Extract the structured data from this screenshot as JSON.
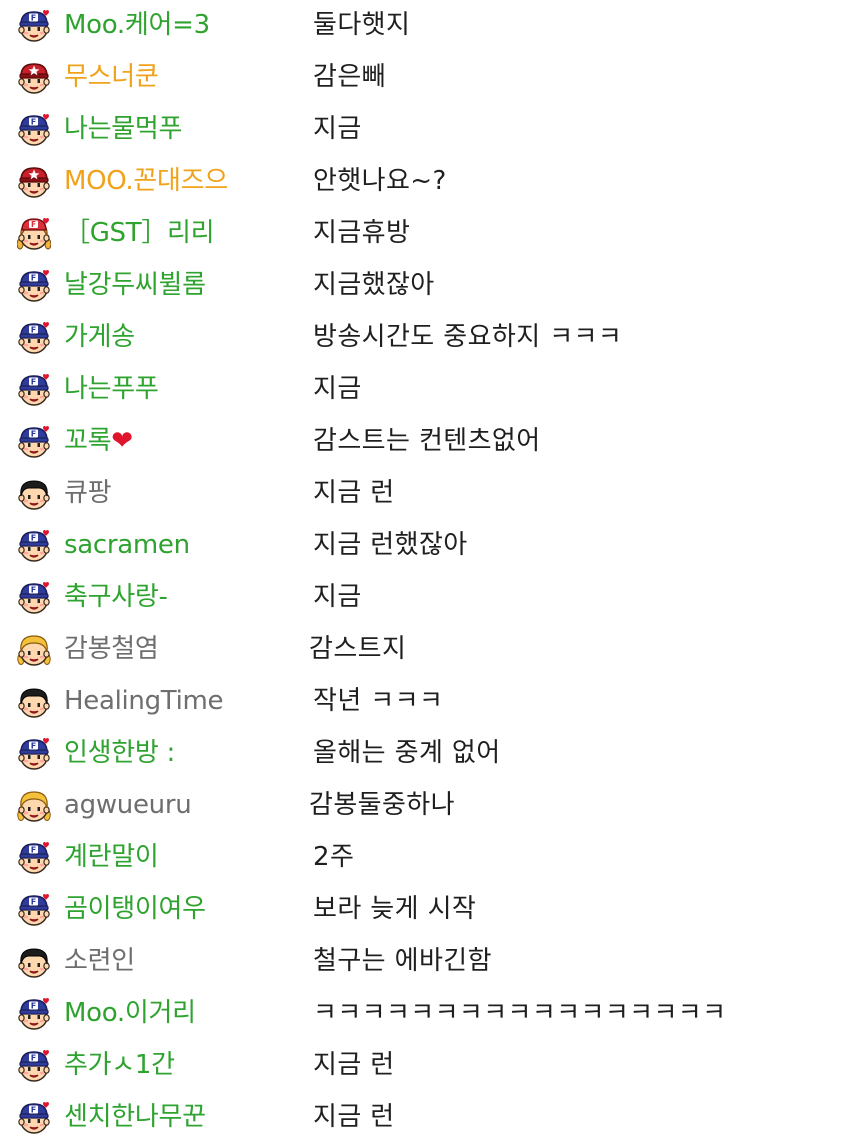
{
  "colors": {
    "fan_nick": "#2fa32f",
    "manager_nick": "#f0a21a",
    "normal_nick": "#6e6e6e",
    "message": "#1f1f1f",
    "heart": "#e0142c"
  },
  "chat": {
    "messages": [
      {
        "nickname": "Moo.케어=3",
        "text": "둘다햇지",
        "badge": "fan-badge-icon",
        "nick_color": "green"
      },
      {
        "nickname": "무스너쿤",
        "text": "감은빼",
        "badge": "manager-badge-icon",
        "nick_color": "orange"
      },
      {
        "nickname": "나는물먹푸",
        "text": "지금",
        "badge": "fan-badge-icon",
        "nick_color": "green"
      },
      {
        "nickname": "MOO.꼰대즈으",
        "text": "안햇나요~?",
        "badge": "manager-badge-icon",
        "nick_color": "orange"
      },
      {
        "nickname": "［GST］리리",
        "text": "지금휴방",
        "badge": "girl-fan-badge-icon",
        "nick_color": "green"
      },
      {
        "nickname": "날강두씨뷜롬",
        "text": "지금했잖아",
        "badge": "fan-badge-icon",
        "nick_color": "green"
      },
      {
        "nickname": "가게송",
        "text": "방송시간도 중요하지 ㅋㅋㅋ",
        "badge": "fan-badge-icon",
        "nick_color": "green"
      },
      {
        "nickname": "나는푸푸",
        "text": "지금",
        "badge": "fan-badge-icon",
        "nick_color": "green"
      },
      {
        "nickname": "꼬록",
        "nick_suffix": "❤",
        "text": "감스트는 컨텐츠없어",
        "badge": "fan-badge-icon",
        "nick_color": "green"
      },
      {
        "nickname": "큐팡",
        "text": "지금 런",
        "badge": "boy-user-icon",
        "nick_color": "gray"
      },
      {
        "nickname": "sacramen",
        "text": "지금 런했잖아",
        "badge": "fan-badge-icon",
        "nick_color": "green"
      },
      {
        "nickname": "축구사랑-",
        "text": "지금",
        "badge": "fan-badge-icon",
        "nick_color": "green"
      },
      {
        "nickname": "감봉철염",
        "text": "감스트지",
        "badge": "girl-user-icon",
        "nick_color": "gray"
      },
      {
        "nickname": "HealingTime",
        "text": "작년 ㅋㅋㅋ",
        "badge": "boy-user-icon",
        "nick_color": "gray"
      },
      {
        "nickname": "인생한방 :",
        "text": "올해는 중계 없어",
        "badge": "fan-badge-icon",
        "nick_color": "green"
      },
      {
        "nickname": "agwueuru",
        "text": "감봉둘중하나",
        "badge": "girl-user-icon",
        "nick_color": "gray"
      },
      {
        "nickname": "계란말이",
        "text": "2주",
        "badge": "fan-badge-icon",
        "nick_color": "green"
      },
      {
        "nickname": "곰이탱이여우",
        "text": "보라 늦게 시작",
        "badge": "fan-badge-icon",
        "nick_color": "green"
      },
      {
        "nickname": "소련인",
        "text": "철구는 에바긴함",
        "badge": "boy-user-icon",
        "nick_color": "gray"
      },
      {
        "nickname": "Moo.이거리",
        "text": "ㅋㅋㅋㅋㅋㅋㅋㅋㅋㅋㅋㅋㅋㅋㅋㅋㅋ",
        "badge": "fan-badge-icon",
        "nick_color": "green"
      },
      {
        "nickname": "추가ㅅ1간",
        "text": "지금 런",
        "badge": "fan-badge-icon",
        "nick_color": "green"
      },
      {
        "nickname": "센치한나무꾼",
        "text": "지금 런",
        "badge": "fan-badge-icon",
        "nick_color": "green"
      }
    ]
  }
}
